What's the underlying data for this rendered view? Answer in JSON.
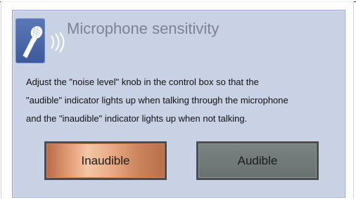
{
  "header": {
    "title": "Microphone sensitivity",
    "icon": "microphone-icon"
  },
  "instructions": {
    "line1": "Adjust the \"noise level\" knob in the control box so that the",
    "line2": "\"audible\" indicator lights up when talking through the microphone",
    "line3": "and the \"inaudible\" indicator lights up when not talking."
  },
  "indicators": {
    "inaudible_label": "Inaudible",
    "audible_label": "Audible",
    "inaudible_active": true,
    "audible_active": false,
    "active_color": "#e3a07a",
    "inactive_color": "#6f7777"
  },
  "colors": {
    "panel_bg": "#c9d1e4",
    "title_text": "#7d8296",
    "icon_bg": "#4a68aa"
  }
}
